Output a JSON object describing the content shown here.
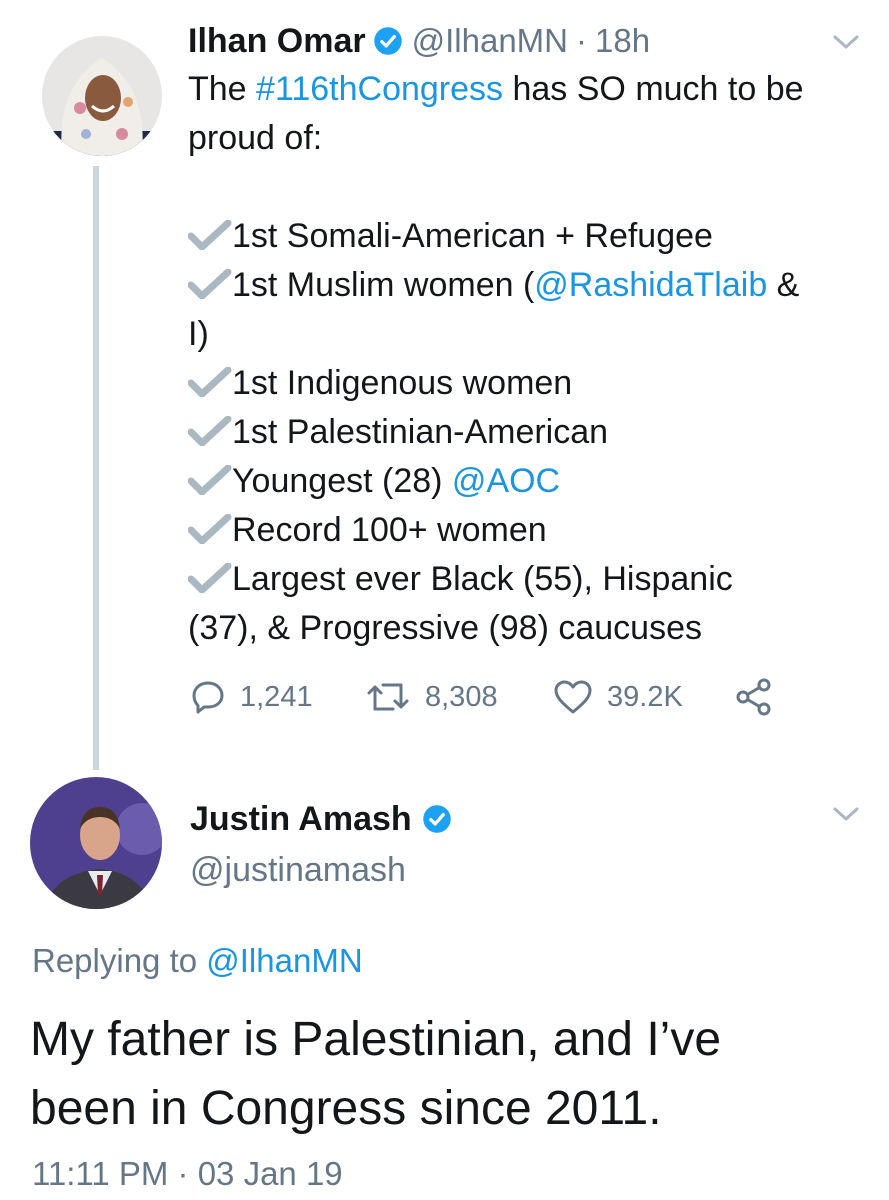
{
  "tweet1": {
    "author_name": "Ilhan Omar",
    "handle": "@IlhanMN",
    "separator": "·",
    "time": "18h",
    "text_intro": "The ",
    "hashtag": "#116thCongress",
    "text_rest": " has SO much to be",
    "text_line2": "proud of:",
    "items": [
      {
        "text": "1st Somali-American + Refugee"
      },
      {
        "text_before": "1st Muslim women (",
        "mention": "@RashidaTlaib",
        "text_after": " &",
        "continuation": "I)"
      },
      {
        "text": "1st Indigenous women"
      },
      {
        "text": "1st Palestinian-American"
      },
      {
        "text_before": "Youngest (28) ",
        "mention": "@AOC"
      },
      {
        "text": "Record 100+ women"
      },
      {
        "text": "Largest ever Black (55), Hispanic",
        "continuation": "(37), & Progressive (98) caucuses"
      }
    ],
    "actions": {
      "replies": "1,241",
      "retweets": "8,308",
      "likes": "39.2K"
    }
  },
  "tweet2": {
    "author_name": "Justin Amash",
    "handle": "@justinamash",
    "replying_label": "Replying to ",
    "replying_handle": "@IlhanMN",
    "text_line1": "My father is Palestinian, and I’ve",
    "text_line2": "been in Congress since 2011.",
    "timestamp_time": "11:11 PM",
    "separator": "·",
    "timestamp_date": "03 Jan 19"
  },
  "colors": {
    "link": "#1b95e0",
    "gray_text": "#657786",
    "check_gray": "#aab8c2",
    "thread_line": "#ccd6dd",
    "verified": "#1da1f2"
  },
  "icons": [
    "verified-badge-icon",
    "chevron-down-icon",
    "checkmark-icon",
    "reply-icon",
    "retweet-icon",
    "like-icon",
    "share-icon"
  ]
}
